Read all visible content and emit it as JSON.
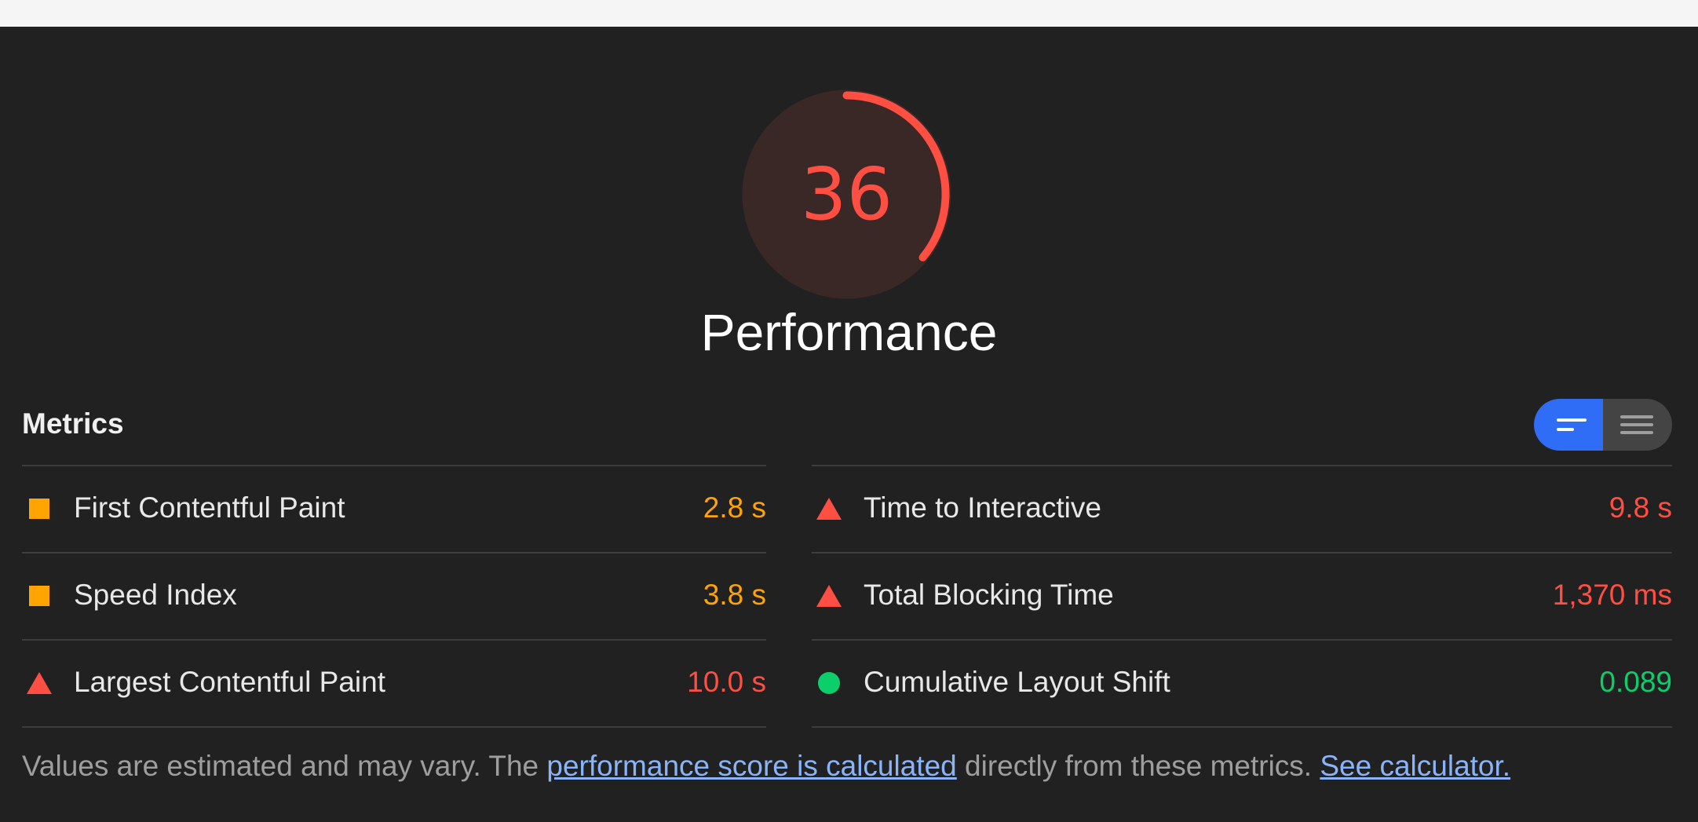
{
  "colors": {
    "fail": "#ff4e42",
    "average": "#ffa400",
    "pass": "#0cce6b",
    "toggle_active": "#2f6df6"
  },
  "gauge": {
    "score": "36",
    "score_fraction": 0.36,
    "title": "Performance"
  },
  "metrics": {
    "title": "Metrics",
    "toggle": {
      "active_view": "summary"
    },
    "items": [
      {
        "label": "First Contentful Paint",
        "value": "2.8 s",
        "status": "average",
        "icon": "orange-square-icon"
      },
      {
        "label": "Speed Index",
        "value": "3.8 s",
        "status": "average",
        "icon": "orange-square-icon"
      },
      {
        "label": "Largest Contentful Paint",
        "value": "10.0 s",
        "status": "fail",
        "icon": "red-triangle-icon"
      },
      {
        "label": "Time to Interactive",
        "value": "9.8 s",
        "status": "fail",
        "icon": "red-triangle-icon"
      },
      {
        "label": "Total Blocking Time",
        "value": "1,370 ms",
        "status": "fail",
        "icon": "red-triangle-icon"
      },
      {
        "label": "Cumulative Layout Shift",
        "value": "0.089",
        "status": "pass",
        "icon": "green-circle-icon"
      }
    ]
  },
  "footnote": {
    "prefix": "Values are estimated and may vary. The ",
    "link1": "performance score is calculated",
    "middle": " directly from these metrics. ",
    "link2": "See calculator."
  }
}
